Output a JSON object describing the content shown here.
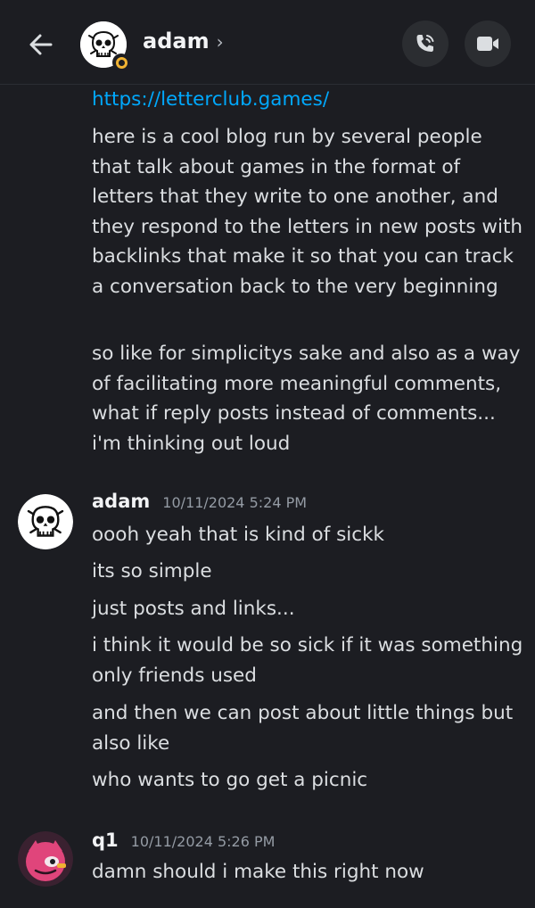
{
  "header": {
    "title": "adam",
    "chevron": "›",
    "back_icon": "arrow-left-icon",
    "call_icon": "phone-call-icon",
    "video_icon": "video-camera-icon",
    "status_color": "#f0b232"
  },
  "messages": {
    "continued": {
      "link": "https://letterclub.games/",
      "lines": [
        "here is a cool blog run by several people that talk about games in the format of letters that they write to one another, and they respond to the letters in new posts with backlinks that make it so that you can track a conversation back to the very beginning",
        "so like for simplicitys sake and also as a way of facilitating more meaningful comments, what if reply posts instead of comments... i'm thinking out loud"
      ]
    },
    "group_adam": {
      "author": "adam",
      "timestamp": "10/11/2024 5:24 PM",
      "lines": [
        "oooh yeah that is kind of sickk",
        "its so simple",
        "just posts and links...",
        "i think it would be so sick if it was something only friends used",
        "and then we can post about little things but also like",
        "who wants to go get a picnic"
      ]
    },
    "group_q1": {
      "author": "q1",
      "timestamp": "10/11/2024 5:26 PM",
      "lines": [
        "damn should i make this right now"
      ]
    }
  },
  "colors": {
    "background": "#1c1d22",
    "link": "#00a8fc",
    "text": "#dbdee1",
    "muted": "#949ba4",
    "q1_avatar": "#e0457b"
  }
}
